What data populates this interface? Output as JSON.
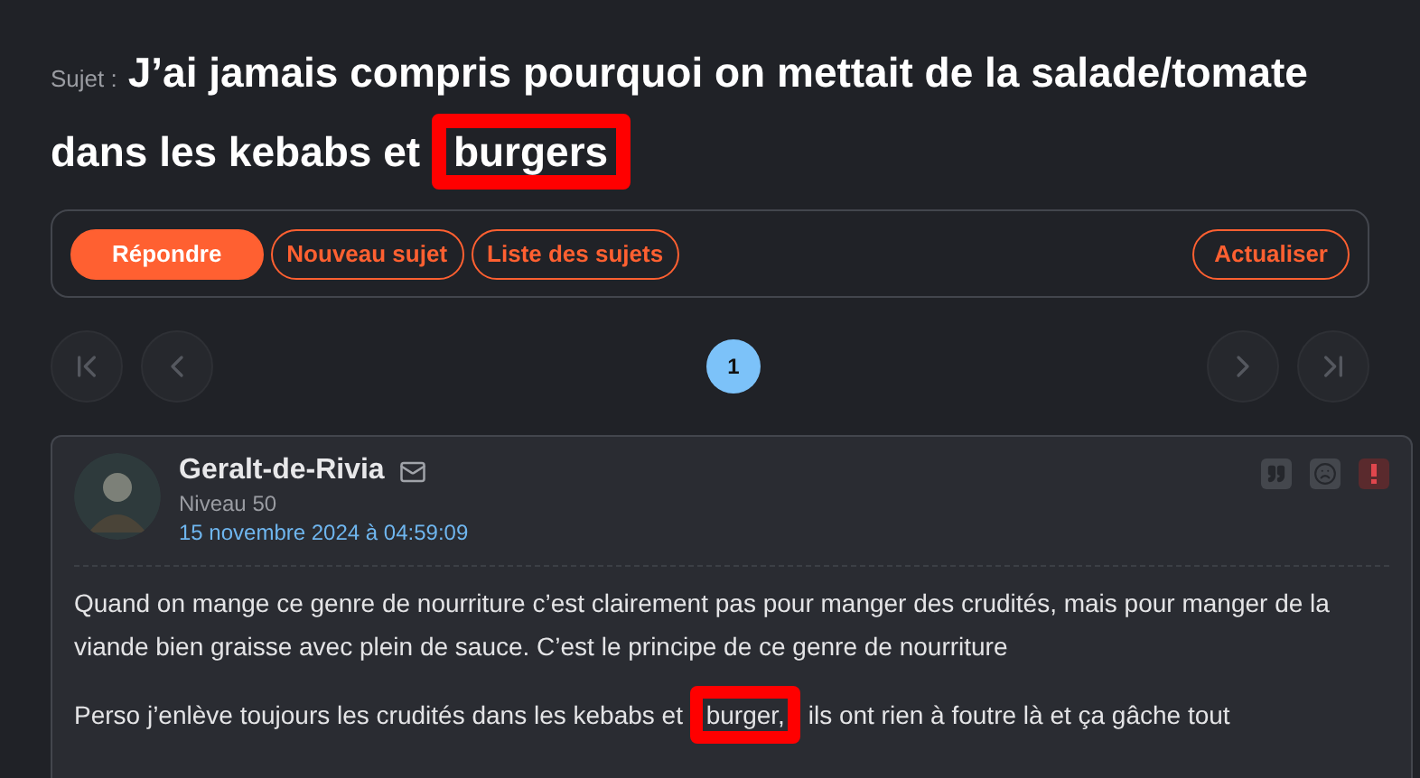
{
  "topic": {
    "label": "Sujet :",
    "segments": [
      {
        "text": "J’ai jamais compris pourquoi on mettait de la salade/tomate dans les kebabs et",
        "highlighted": false
      },
      {
        "text": "burgers",
        "highlighted": true
      }
    ]
  },
  "toolbar": {
    "buttons": [
      {
        "label": "Répondre",
        "kind": "primary"
      },
      {
        "label": "Nouveau sujet",
        "kind": "outline"
      },
      {
        "label": "Liste des sujets",
        "kind": "outline"
      }
    ],
    "refresh": "Actualiser"
  },
  "pagination": {
    "pages": [
      {
        "label": "1",
        "selected": true
      }
    ]
  },
  "post": {
    "author": "Geralt-de-Rivia",
    "level": "Niveau 50",
    "date": "15 novembre 2024 à 04:59:09",
    "paragraphs": [
      {
        "segments": [
          {
            "text": "Quand on mange ce genre de nourriture c’est clairement pas pour manger des crudités, mais pour manger de la viande bien graisse avec plein de sauce. C’est le principe de ce genre de nourriture",
            "highlighted": false
          }
        ]
      },
      {
        "segments": [
          {
            "text": "Perso j’enlève toujours les crudités dans les kebabs et",
            "highlighted": false
          },
          {
            "text": "burger,",
            "highlighted": true
          },
          {
            "text": "ils ont rien à foutre là et ça gâche tout",
            "highlighted": false
          }
        ]
      }
    ]
  }
}
